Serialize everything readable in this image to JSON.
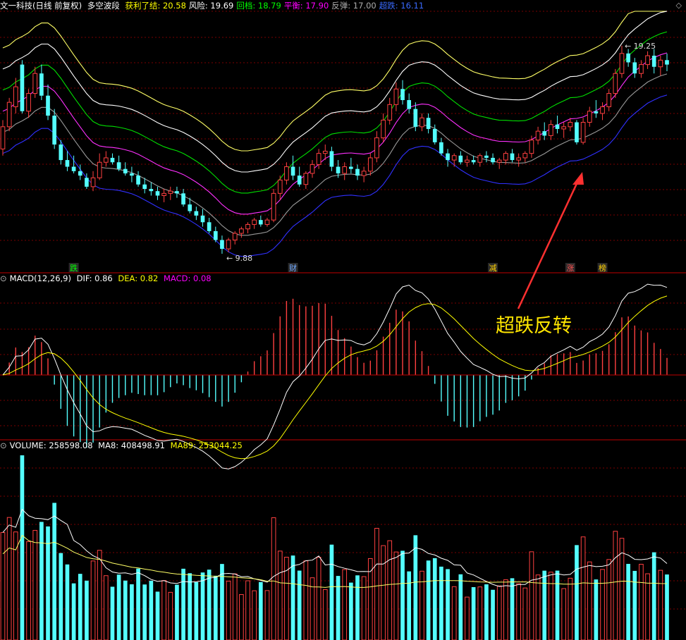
{
  "header": {
    "title": "文一科技(日线 前复权)",
    "indicator": "多空波段",
    "items": [
      {
        "label": "获利了结:",
        "value": "20.58",
        "color": "#ffff00"
      },
      {
        "label": "风险:",
        "value": "19.69",
        "color": "#ffffff"
      },
      {
        "label": "回档:",
        "value": "18.79",
        "color": "#00ff00"
      },
      {
        "label": "平衡:",
        "value": "17.90",
        "color": "#ff00ff"
      },
      {
        "label": "反弹:",
        "value": "17.00",
        "color": "#aaaaaa"
      },
      {
        "label": "超跌:",
        "value": "16.11",
        "color": "#3a6bff"
      }
    ]
  },
  "macd_header": {
    "name": "MACD(12,26,9)",
    "dif": "DIF: 0.86",
    "dea": "DEA: 0.82",
    "macd": "MACD: 0.08"
  },
  "vol_header": {
    "name": "VOLUME: 258598.08",
    "ma8": "MA8: 408498.91",
    "ma89": "MA89: 253044.25"
  },
  "annotation": "超跌反转",
  "low_label": "9.88",
  "high_label": "19.25",
  "markers": [
    {
      "text": "跌",
      "color": "#00ff00"
    },
    {
      "text": "财",
      "color": "#6fa8ff"
    },
    {
      "text": "减",
      "color": "#ffd000"
    },
    {
      "text": "涨",
      "color": "#ff5050"
    },
    {
      "text": "榜",
      "color": "#ffd000"
    }
  ],
  "colors": {
    "up": "#ff4040",
    "down": "#54ffff",
    "grid": "#7a0000",
    "bg": "#000000"
  },
  "chart_data": {
    "type": "candlestick",
    "candles": [
      [
        14.6,
        15.9,
        14.3,
        15.6
      ],
      [
        15.6,
        16.9,
        15.4,
        16.7
      ],
      [
        16.5,
        17.8,
        16.2,
        17.4
      ],
      [
        18.4,
        18.6,
        16.2,
        16.3
      ],
      [
        16.3,
        17.3,
        16.0,
        17.1
      ],
      [
        17.1,
        18.3,
        16.9,
        18.0
      ],
      [
        18.0,
        18.4,
        16.8,
        17.0
      ],
      [
        17.0,
        17.5,
        15.9,
        16.1
      ],
      [
        16.1,
        16.4,
        14.6,
        14.8
      ],
      [
        14.8,
        15.0,
        13.9,
        14.1
      ],
      [
        14.1,
        14.5,
        13.6,
        13.8
      ],
      [
        13.8,
        14.3,
        13.5,
        13.6
      ],
      [
        13.6,
        13.9,
        13.2,
        13.4
      ],
      [
        13.3,
        13.5,
        12.8,
        12.9
      ],
      [
        12.9,
        13.6,
        12.7,
        13.3
      ],
      [
        13.3,
        14.4,
        13.2,
        14.0
      ],
      [
        14.0,
        14.5,
        13.8,
        14.2
      ],
      [
        14.2,
        14.4,
        13.9,
        14.0
      ],
      [
        14.0,
        14.3,
        13.6,
        13.7
      ],
      [
        13.7,
        14.0,
        13.4,
        13.5
      ],
      [
        13.5,
        13.8,
        13.1,
        13.4
      ],
      [
        13.4,
        13.6,
        12.9,
        13.0
      ],
      [
        13.0,
        13.3,
        12.6,
        12.8
      ],
      [
        12.8,
        13.1,
        12.5,
        12.7
      ],
      [
        12.7,
        12.9,
        12.3,
        12.5
      ],
      [
        12.5,
        12.8,
        12.2,
        12.6
      ],
      [
        12.6,
        12.9,
        12.3,
        12.7
      ],
      [
        12.7,
        12.9,
        12.4,
        12.6
      ],
      [
        12.6,
        12.8,
        12.0,
        12.1
      ],
      [
        12.1,
        12.4,
        11.7,
        11.8
      ],
      [
        11.8,
        12.0,
        11.4,
        11.6
      ],
      [
        11.6,
        11.9,
        11.1,
        11.3
      ],
      [
        11.3,
        11.5,
        10.8,
        10.9
      ],
      [
        10.9,
        11.1,
        10.4,
        10.5
      ],
      [
        10.5,
        10.7,
        9.88,
        10.1
      ],
      [
        10.1,
        10.6,
        9.95,
        10.5
      ],
      [
        10.5,
        10.9,
        10.3,
        10.8
      ],
      [
        10.8,
        11.1,
        10.6,
        11.0
      ],
      [
        11.0,
        11.3,
        10.8,
        11.2
      ],
      [
        11.2,
        11.5,
        11.0,
        11.4
      ],
      [
        11.4,
        11.6,
        11.1,
        11.2
      ],
      [
        11.2,
        11.5,
        11.1,
        11.4
      ],
      [
        11.4,
        12.8,
        11.3,
        12.6
      ],
      [
        12.6,
        13.4,
        12.3,
        13.2
      ],
      [
        13.2,
        14.0,
        13.0,
        13.8
      ],
      [
        13.8,
        14.3,
        13.2,
        13.4
      ],
      [
        13.4,
        13.8,
        12.9,
        13.0
      ],
      [
        13.0,
        13.6,
        12.8,
        13.5
      ],
      [
        13.5,
        14.1,
        13.3,
        13.9
      ],
      [
        13.9,
        14.6,
        13.7,
        14.4
      ],
      [
        14.4,
        14.8,
        14.1,
        14.5
      ],
      [
        14.5,
        14.7,
        13.6,
        13.8
      ],
      [
        13.8,
        14.1,
        13.3,
        13.5
      ],
      [
        13.5,
        14.0,
        13.2,
        13.8
      ],
      [
        13.8,
        14.2,
        13.5,
        13.7
      ],
      [
        13.7,
        13.9,
        13.2,
        13.4
      ],
      [
        13.4,
        13.8,
        13.1,
        13.6
      ],
      [
        13.6,
        14.4,
        13.4,
        14.2
      ],
      [
        14.2,
        15.4,
        14.0,
        15.1
      ],
      [
        15.1,
        16.2,
        14.9,
        15.9
      ],
      [
        15.9,
        16.9,
        15.7,
        16.6
      ],
      [
        16.6,
        17.6,
        16.3,
        17.3
      ],
      [
        17.3,
        17.7,
        16.6,
        16.8
      ],
      [
        16.8,
        17.1,
        16.2,
        16.4
      ],
      [
        16.4,
        16.7,
        15.4,
        15.6
      ],
      [
        15.6,
        16.2,
        15.4,
        16.0
      ],
      [
        16.0,
        16.2,
        15.3,
        15.5
      ],
      [
        15.5,
        15.7,
        14.8,
        14.9
      ],
      [
        14.9,
        15.1,
        14.3,
        14.4
      ],
      [
        14.4,
        14.6,
        13.8,
        14.1
      ],
      [
        14.1,
        14.4,
        13.8,
        14.3
      ],
      [
        14.3,
        14.5,
        13.9,
        14.0
      ],
      [
        14.0,
        14.3,
        13.8,
        14.1
      ],
      [
        14.1,
        14.3,
        13.9,
        14.0
      ],
      [
        14.0,
        14.4,
        13.8,
        14.3
      ],
      [
        14.3,
        14.5,
        14.0,
        14.2
      ],
      [
        14.2,
        14.4,
        13.9,
        14.0
      ],
      [
        14.0,
        14.2,
        13.7,
        14.1
      ],
      [
        14.1,
        14.5,
        13.9,
        14.4
      ],
      [
        14.4,
        14.6,
        14.0,
        14.1
      ],
      [
        14.1,
        14.4,
        13.8,
        14.2
      ],
      [
        14.2,
        14.5,
        14.0,
        14.4
      ],
      [
        14.4,
        15.2,
        14.2,
        15.0
      ],
      [
        15.0,
        15.6,
        14.8,
        15.4
      ],
      [
        15.4,
        15.8,
        15.0,
        15.2
      ],
      [
        15.2,
        15.9,
        15.0,
        15.7
      ],
      [
        15.7,
        16.1,
        15.3,
        15.5
      ],
      [
        15.5,
        15.8,
        15.1,
        15.6
      ],
      [
        15.6,
        16.0,
        15.4,
        15.8
      ],
      [
        15.8,
        15.9,
        14.8,
        14.9
      ],
      [
        14.9,
        16.0,
        14.8,
        15.8
      ],
      [
        15.8,
        16.5,
        15.6,
        16.3
      ],
      [
        16.3,
        16.8,
        16.0,
        16.2
      ],
      [
        16.2,
        16.7,
        15.9,
        16.5
      ],
      [
        16.5,
        17.3,
        16.3,
        17.1
      ],
      [
        17.1,
        18.2,
        16.9,
        18.0
      ],
      [
        18.0,
        19.25,
        17.8,
        18.9
      ],
      [
        18.9,
        19.1,
        18.3,
        18.5
      ],
      [
        18.5,
        18.7,
        17.8,
        18.0
      ],
      [
        18.0,
        18.6,
        17.8,
        18.4
      ],
      [
        18.4,
        19.0,
        18.2,
        18.8
      ],
      [
        18.8,
        19.1,
        18.0,
        18.3
      ],
      [
        18.3,
        18.8,
        17.9,
        18.6
      ],
      [
        18.6,
        18.9,
        18.1,
        18.4
      ]
    ],
    "bands": {
      "获利了结_end": 20.58,
      "风险_end": 19.69,
      "回档_end": 18.79,
      "平衡_end": 17.9,
      "反弹_end": 17.0,
      "超跌_end": 16.11
    },
    "price_range": [
      9.5,
      20.8
    ],
    "macd": {
      "dif_end": 0.86,
      "dea_end": 0.82,
      "macd_end": 0.08,
      "range": [
        -0.95,
        1.05
      ]
    },
    "volume": {
      "last": 258598.08,
      "ma8": 408498.91,
      "ma89": 253044.25
    }
  }
}
